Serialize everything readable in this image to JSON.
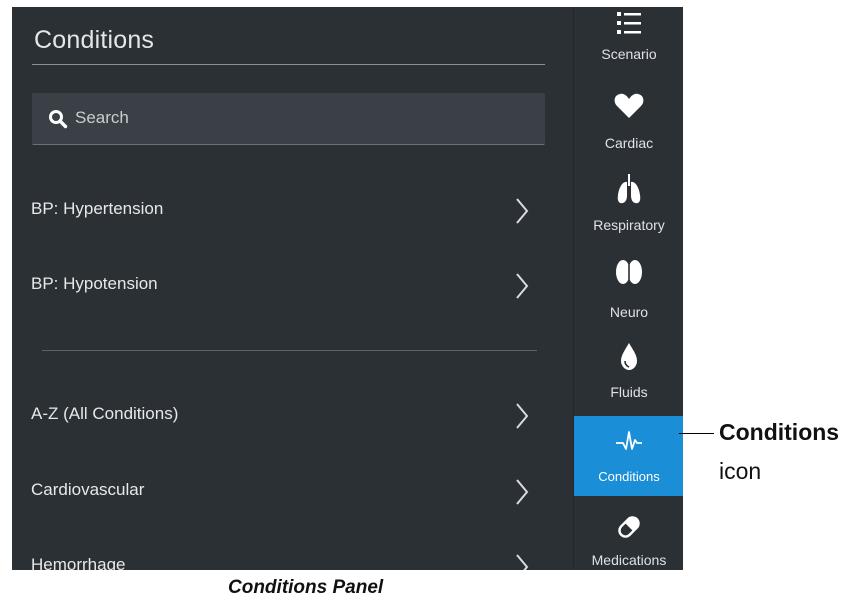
{
  "panel": {
    "title": "Conditions",
    "search_placeholder": "Search",
    "items": [
      {
        "label": "BP: Hypertension"
      },
      {
        "label": "BP: Hypotension"
      },
      {
        "label": "A-Z (All Conditions)"
      },
      {
        "label": "Cardiovascular"
      },
      {
        "label": "Hemorrhage"
      }
    ]
  },
  "sidebar": {
    "items": [
      {
        "label": "Scenario",
        "icon": "list-icon"
      },
      {
        "label": "Cardiac",
        "icon": "heart-icon"
      },
      {
        "label": "Respiratory",
        "icon": "lungs-icon"
      },
      {
        "label": "Neuro",
        "icon": "brain-icon"
      },
      {
        "label": "Fluids",
        "icon": "droplet-icon"
      },
      {
        "label": "Conditions",
        "icon": "pulse-icon",
        "active": true
      },
      {
        "label": "Medications",
        "icon": "pill-icon"
      }
    ],
    "active_color": "#1a8fd8"
  },
  "annotation": {
    "callout_bold": "Conditions",
    "callout_regular": "icon",
    "caption": "Conditions Panel"
  }
}
